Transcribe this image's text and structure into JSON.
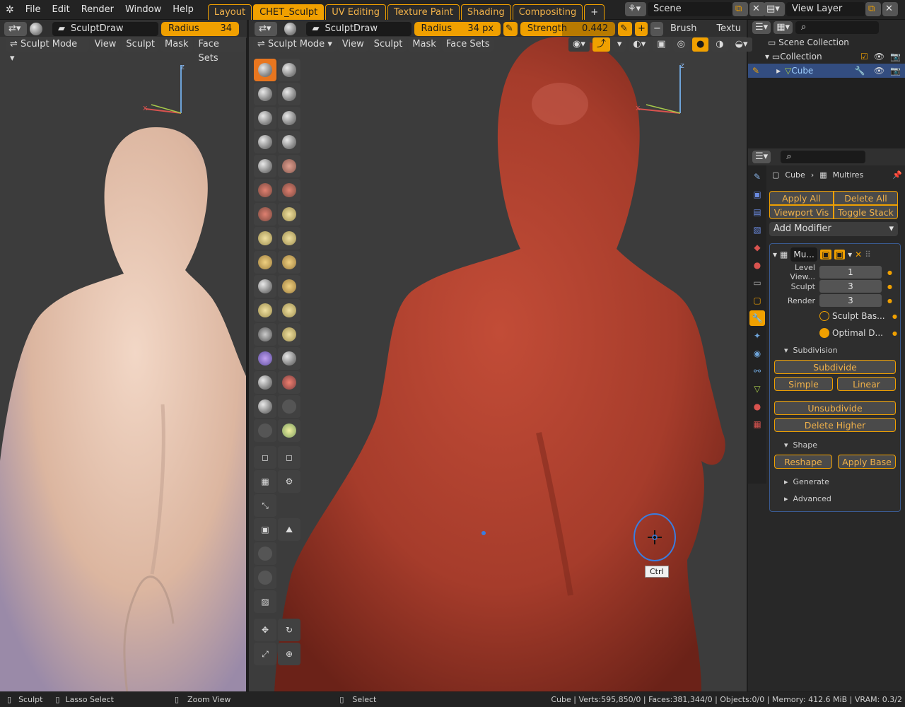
{
  "menubar": {
    "items": [
      "File",
      "Edit",
      "Render",
      "Window",
      "Help"
    ]
  },
  "workspaces": [
    "Layout",
    "CHET_Sculpt",
    "UV Editing",
    "Texture Paint",
    "Shading",
    "Compositing"
  ],
  "workspace_active": "CHET_Sculpt",
  "add_tab": "+",
  "scene": "Scene",
  "view_layer": "View Layer",
  "left_header": {
    "brush": "SculptDraw",
    "radius_label": "Radius",
    "radius_value": "34"
  },
  "main_header": {
    "brush": "SculptDraw",
    "radius_label": "Radius",
    "radius_value": "34 px",
    "strength_label": "Strength",
    "strength_value": "0.442",
    "plus": "+",
    "minus": "−",
    "brush_menu": "Brush",
    "texture_menu": "Textu"
  },
  "left_menus": {
    "mode": "Sculpt Mode",
    "items": [
      "View",
      "Sculpt",
      "Mask",
      "Face Sets"
    ]
  },
  "main_menus": {
    "mode": "Sculpt Mode",
    "items": [
      "View",
      "Sculpt",
      "Mask",
      "Face Sets"
    ]
  },
  "axis": {
    "z": "z",
    "x": "x"
  },
  "outliner": {
    "scene_collection": "Scene Collection",
    "collection": "Collection",
    "object": "Cube"
  },
  "properties": {
    "breadcrumb_object": "Cube",
    "breadcrumb_modifier": "Multires",
    "apply_all": "Apply All",
    "delete_all": "Delete All",
    "viewport_vis": "Viewport Vis",
    "toggle_stack": "Toggle Stack",
    "add_modifier": "Add Modifier",
    "modifier_name": "Mu...",
    "level_viewport_label": "Level View...",
    "level_viewport": "1",
    "sculpt_label": "Sculpt",
    "sculpt": "3",
    "render_label": "Render",
    "render": "3",
    "sculpt_base": "Sculpt Bas...",
    "optimal_display": "Optimal D...",
    "subdivision": "Subdivision",
    "subdivide": "Subdivide",
    "simple": "Simple",
    "linear": "Linear",
    "unsubdivide": "Unsubdivide",
    "delete_higher": "Delete Higher",
    "shape": "Shape",
    "reshape": "Reshape",
    "apply_base": "Apply Base",
    "generate": "Generate",
    "advanced": "Advanced"
  },
  "tooltip": "Ctrl",
  "status": {
    "sculpt": "Sculpt",
    "lasso": "Lasso Select",
    "zoom": "Zoom View",
    "select": "Select",
    "stats": "Cube | Verts:595,850/0 | Faces:381,344/0 | Objects:0/0 | Memory: 412.6 MiB | VRAM: 0.3/2"
  },
  "colors": {
    "accent": "#f0a000",
    "active_tool": "#e8761f",
    "model_main": "#b3402e",
    "model_left": "#e8c7b2"
  }
}
